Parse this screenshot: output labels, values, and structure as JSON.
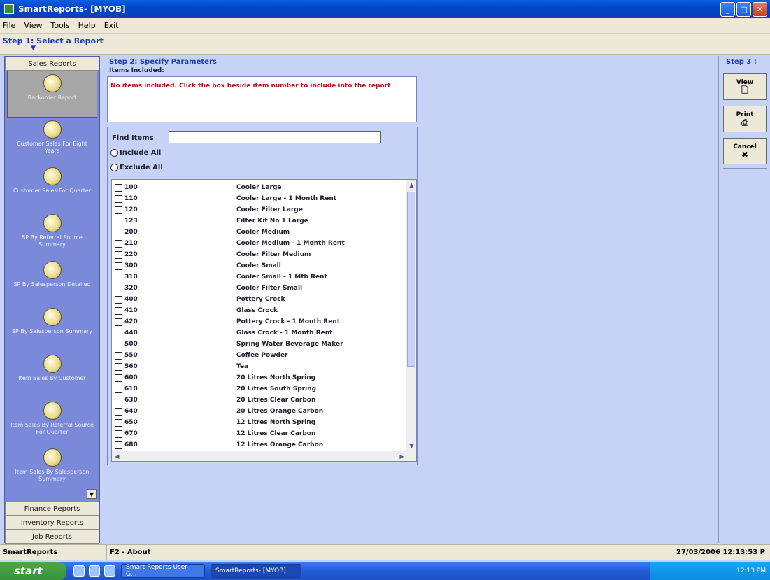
{
  "window": {
    "title": "SmartReports- [MYOB]",
    "minimize": "_",
    "maximize": "□",
    "close": "✕"
  },
  "menu": [
    "File",
    "View",
    "Tools",
    "Help",
    "Exit"
  ],
  "step1": {
    "label": "Step 1: Select a Report"
  },
  "sidebar": {
    "group_top": "Sales Reports",
    "reports": [
      "Backorder Report",
      "Customer Sales For Eight Years",
      "Customer Sales For Quarter",
      "SP By Referral Source Summary",
      "SP By Salesperson Detailed",
      "SP By Salesperson Summary",
      "Item Sales By Customer",
      "Item Sales By Referral Source For Quarter",
      "Item Sales By Salesperson Summary",
      ""
    ],
    "groups_bottom": [
      "Finance Reports",
      "Inventory Reports",
      "Job Reports"
    ]
  },
  "step2": {
    "label": "Step 2: Specify Parameters",
    "items_included_label": "Items Included:",
    "included_message": "No items included. Click the box beside item number to include into the report",
    "find_label": "Find Items",
    "find_value": "",
    "include_all": "Include All",
    "exclude_all": "Exclude All"
  },
  "items": [
    {
      "code": "100",
      "name": "Cooler Large"
    },
    {
      "code": "110",
      "name": "Cooler Large - 1 Month Rent"
    },
    {
      "code": "120",
      "name": "Cooler Filter Large"
    },
    {
      "code": "123",
      "name": "Filter Kit No 1 Large"
    },
    {
      "code": "200",
      "name": "Cooler Medium"
    },
    {
      "code": "210",
      "name": "Cooler Medium - 1 Month Rent"
    },
    {
      "code": "220",
      "name": "Cooler Filter Medium"
    },
    {
      "code": "300",
      "name": "Cooler Small"
    },
    {
      "code": "310",
      "name": "Cooler Small - 1 Mth Rent"
    },
    {
      "code": "320",
      "name": "Cooler Filter Small"
    },
    {
      "code": "400",
      "name": "Pottery Crock"
    },
    {
      "code": "410",
      "name": "Glass Crock"
    },
    {
      "code": "420",
      "name": "Pottery Crock - 1 Month Rent"
    },
    {
      "code": "440",
      "name": "Glass Crock - 1 Month Rent"
    },
    {
      "code": "500",
      "name": "Spring Water Beverage Maker"
    },
    {
      "code": "550",
      "name": "Coffee Powder"
    },
    {
      "code": "560",
      "name": "Tea"
    },
    {
      "code": "600",
      "name": "20 Litres North Spring"
    },
    {
      "code": "610",
      "name": "20 Litres South Spring"
    },
    {
      "code": "630",
      "name": "20 Litres Clear Carbon"
    },
    {
      "code": "640",
      "name": "20 Litres Orange Carbon"
    },
    {
      "code": "650",
      "name": "12 Litres North Spring"
    },
    {
      "code": "670",
      "name": "12 Litres Clear Carbon"
    },
    {
      "code": "680",
      "name": "12 Litres Orange Carbon"
    }
  ],
  "step3": {
    "label": "Step 3 :",
    "view": "View",
    "print": "Print",
    "cancel": "Cancel"
  },
  "status": {
    "app": "SmartReports",
    "hint": "F2 - About",
    "datetime": "27/03/2006 12:13:53 P"
  },
  "taskbar": {
    "start": "start",
    "tasks": [
      "Smart Reports User G...",
      "SmartReports- [MYOB]"
    ],
    "clock": "12:13 PM"
  }
}
